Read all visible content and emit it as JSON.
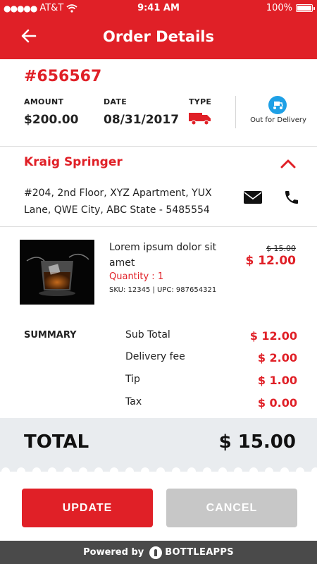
{
  "status_bar": {
    "carrier": "AT&T",
    "time": "9:41 AM",
    "battery": "100%"
  },
  "header": {
    "title": "Order Details",
    "back_icon": "arrow-left-icon"
  },
  "order": {
    "id": "#656567",
    "amount_label": "AMOUNT",
    "amount": "$200.00",
    "date_label": "DATE",
    "date": "08/31/2017",
    "type_label": "TYPE",
    "type_icon": "truck-icon",
    "status_icon": "delivery-scooter-icon",
    "status": "Out for Delivery"
  },
  "customer": {
    "name": "Kraig Springer",
    "address": "#204, 2nd Floor, XYZ Apartment, YUX Lane, QWE City, ABC State - 5485554",
    "mail_icon": "mail-icon",
    "phone_icon": "phone-icon"
  },
  "product": {
    "name": "Lorem ipsum dolor sit amet",
    "quantity": "Quantity : 1",
    "sku": "SKU: 12345 | UPC: 987654321",
    "old_price": "$ 15.00",
    "price": "$ 12.00"
  },
  "summary": {
    "label": "SUMMARY",
    "rows": [
      {
        "label": "Sub Total",
        "value": "$ 12.00"
      },
      {
        "label": "Delivery fee",
        "value": "$ 2.00"
      },
      {
        "label": "Tip",
        "value": "$ 1.00"
      },
      {
        "label": "Tax",
        "value": "$ 0.00"
      }
    ]
  },
  "total": {
    "label": "TOTAL",
    "value": "$ 15.00"
  },
  "actions": {
    "update": "UPDATE",
    "cancel": "CANCEL"
  },
  "footer": {
    "powered": "Powered by",
    "brand": "BOTTLEAPPS"
  },
  "colors": {
    "primary": "#e02027",
    "status_blue": "#1ea0e6",
    "cancel_gray": "#c7c7c7",
    "footer_bg": "#4a4a4a"
  }
}
